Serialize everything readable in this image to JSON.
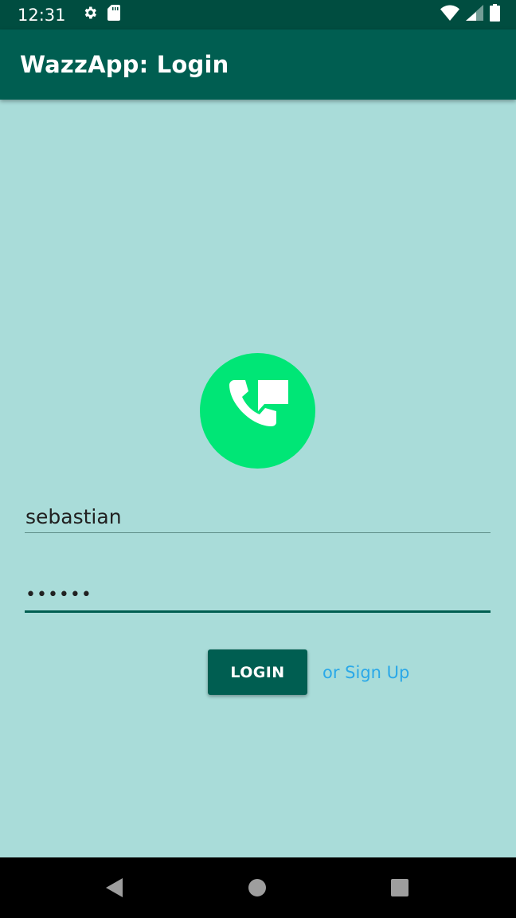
{
  "status_bar": {
    "time": "12:31",
    "icons": [
      "gear-icon",
      "sd-card-icon",
      "wifi-icon",
      "signal-icon",
      "battery-icon"
    ]
  },
  "app_bar": {
    "title": "WazzApp: Login"
  },
  "logo": {
    "icon": "phone-chat-icon",
    "color": "#00e676"
  },
  "form": {
    "username_value": "sebastian",
    "password_value": "••••••",
    "login_label": "LOGIN",
    "signup_label": "or Sign Up"
  },
  "nav_bar": {
    "icons": [
      "back-icon",
      "home-icon",
      "recents-icon"
    ]
  },
  "colors": {
    "background": "#a9dcd9",
    "primary": "#005e51",
    "status_bar": "#004d40",
    "accent_link": "#2aa8e8"
  }
}
